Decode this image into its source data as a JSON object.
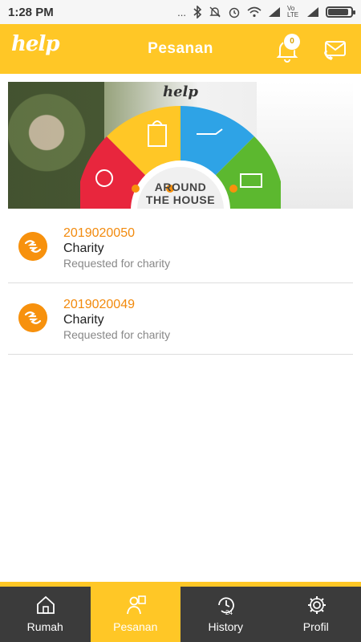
{
  "status_bar": {
    "time": "1:28 PM",
    "dots": "...",
    "volte": "Vo LTE",
    "battery_level": 0.9
  },
  "app_bar": {
    "logo": "help",
    "title": "Pesanan",
    "notification_count": "0"
  },
  "banner": {
    "logo": "help",
    "caption_line1": "AROUND",
    "caption_line2": "THE HOUSE"
  },
  "orders": [
    {
      "id": "2019020050",
      "title": "Charity",
      "subtitle": "Requested for charity"
    },
    {
      "id": "2019020049",
      "title": "Charity",
      "subtitle": "Requested for charity"
    }
  ],
  "bottom_nav": {
    "items": [
      {
        "label": "Rumah",
        "icon": "home-icon",
        "active": false
      },
      {
        "label": "Pesanan",
        "icon": "orders-icon",
        "active": true
      },
      {
        "label": "History",
        "icon": "history-24-icon",
        "active": false
      },
      {
        "label": "Profil",
        "icon": "gear-icon",
        "active": false
      }
    ]
  },
  "colors": {
    "accent": "#ffc726",
    "order_id": "#f28a0d",
    "order_icon": "#f7910d",
    "nav_background": "#3b3b3b"
  }
}
